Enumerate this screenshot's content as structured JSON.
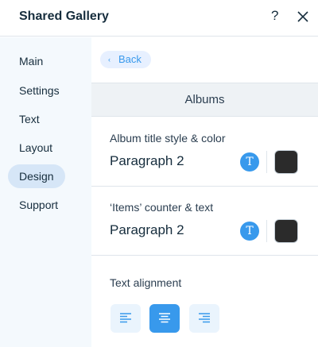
{
  "header": {
    "title": "Shared Gallery",
    "help_label": "?"
  },
  "sidebar": {
    "items": [
      {
        "label": "Main"
      },
      {
        "label": "Settings"
      },
      {
        "label": "Text"
      },
      {
        "label": "Layout"
      },
      {
        "label": "Design",
        "active": true
      },
      {
        "label": "Support"
      }
    ]
  },
  "main": {
    "back_label": "Back",
    "back_chevron": "‹",
    "section_title": "Albums",
    "album_title": {
      "label": "Album title style & color",
      "value": "Paragraph 2",
      "icon": "T",
      "color": "#2b2b2b"
    },
    "items_counter": {
      "label": "‘Items’ counter & text",
      "value": "Paragraph 2",
      "icon": "T",
      "color": "#2b2b2b"
    },
    "text_alignment": {
      "label": "Text alignment",
      "options": [
        "left",
        "center",
        "right"
      ],
      "selected": "center"
    }
  },
  "colors": {
    "accent": "#3899ec",
    "sidebar_bg": "#f4f9fd",
    "active_nav": "#d6e6f7"
  }
}
